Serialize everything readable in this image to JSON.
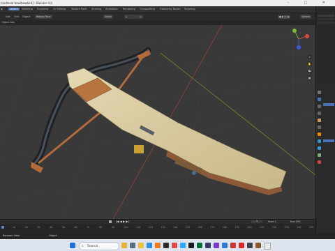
{
  "window": {
    "title": "medieval bow\\bowbird] - Blender 4.0",
    "controls": [
      "–",
      "□",
      "✕"
    ]
  },
  "topbar": {
    "tabs": [
      "Layout",
      "Modeling",
      "Sculpting",
      "UV Editing",
      "Texture Paint",
      "Shading",
      "Animation",
      "Rendering",
      "Compositing",
      "Geometry Nodes",
      "Scripting"
    ],
    "active_tab": "Layout",
    "scene": "Scene"
  },
  "header": {
    "menu": [
      "Add",
      "Grid",
      "Object"
    ],
    "mode": "Object Mode",
    "orientation": "Global",
    "options": "Options",
    "select_box": "Object Box",
    "pivot": "Retopo/Trace"
  },
  "viewport": {
    "object": "crossbow",
    "colors": {
      "background": "#393939",
      "wood": "#d8cba0",
      "rope": "#b46b3c",
      "limb": "#2f3338",
      "accent": "#4772b3"
    }
  },
  "timeline": {
    "ticks": [
      "10",
      "20",
      "30",
      "40",
      "50",
      "60",
      "70",
      "80",
      "90",
      "100",
      "110",
      "120",
      "130",
      "140",
      "150",
      "160",
      "170",
      "180",
      "190",
      "200",
      "210",
      "220",
      "230",
      "240",
      "250"
    ],
    "current_frame": "1",
    "start_label": "Start",
    "start": "1",
    "end_label": "End",
    "end": "250",
    "playhead_left_value": "1"
  },
  "statusbar": {
    "left": "Rename View",
    "mid": "Object"
  },
  "taskbar": {
    "search_placeholder": "Search"
  }
}
